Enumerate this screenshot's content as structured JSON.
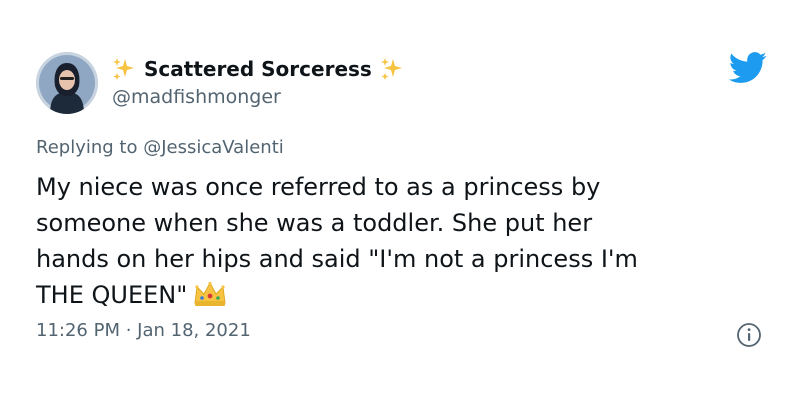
{
  "author": {
    "display_name": "Scattered Sorceress",
    "handle": "@madfishmonger",
    "avatar_icon": "profile-photo",
    "name_decoration_icon": "sparkles-emoji"
  },
  "reply": {
    "prefix": "Replying to ",
    "mention": "@JessicaValenti"
  },
  "tweet": {
    "lines": [
      "My niece was once referred to as a princess by",
      "someone when she was a toddler. She put her",
      "hands on her hips and said \"I'm not a princess I'm",
      "THE QUEEN\""
    ],
    "trailing_emoji": "crown-emoji",
    "timestamp": "11:26 PM · Jan 18, 2021"
  },
  "icons": {
    "brand": "twitter-bird-icon",
    "info": "info-icon"
  },
  "colors": {
    "brand_blue": "#1d9bf0",
    "text_primary": "#0f1419",
    "text_secondary": "#536471",
    "sparkle_gold": "#f6c343"
  }
}
